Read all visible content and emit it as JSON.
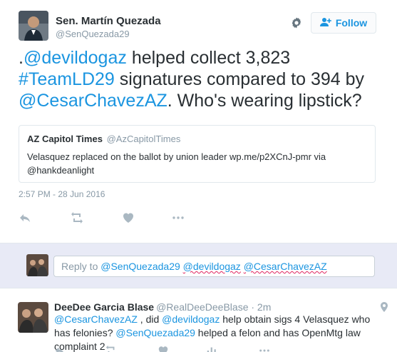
{
  "tweet": {
    "author_name": "Sen. Martín Quezada",
    "author_handle": "@SenQuezada29",
    "follow_label": "Follow",
    "text_parts": {
      "lead": ".",
      "mention1": "@devildogaz",
      "mid1": " helped collect 3,823 ",
      "hashtag": "#TeamLD29",
      "mid2": " signatures compared to 394 by ",
      "mention2": "@CesarChavezAZ",
      "tail": ". Who's wearing lipstick?"
    },
    "quote": {
      "name": "AZ Capitol Times",
      "handle": "@AzCapitolTimes",
      "text": "Velasquez replaced on the ballot by union leader wp.me/p2XCnJ-pmr via @hankdeanlight"
    },
    "timestamp": "2:57 PM - 28 Jun 2016"
  },
  "reply_box": {
    "prefix": "Reply to ",
    "mention1": "@SenQuezada29",
    "mention2": "@devildogaz",
    "mention3": "@CesarChavezAZ"
  },
  "reply_tweet": {
    "author_name": "DeeDee Garcia Blase",
    "author_handle": "@RealDeeDeeBlase",
    "time": "· 2m",
    "parts": {
      "m1": "@CesarChavezAZ",
      "t1": " , did ",
      "m2": "@devildogaz",
      "t2": " help obtain sigs 4 Velasquez who has felonies? ",
      "m3": "@SenQuezada29",
      "t3": " helped a felon and has OpenMtg law complaint 2"
    }
  },
  "icons": {
    "gear": "gear-icon",
    "follow": "add-user-icon",
    "reply": "reply-icon",
    "retweet": "retweet-icon",
    "like": "heart-icon",
    "more": "more-icon",
    "analytics": "analytics-icon",
    "location": "location-pin-icon"
  },
  "colors": {
    "link": "#1b95e0",
    "muted": "#8899a6",
    "text": "#292f33",
    "reply_bar_bg": "#e8eaf6"
  }
}
